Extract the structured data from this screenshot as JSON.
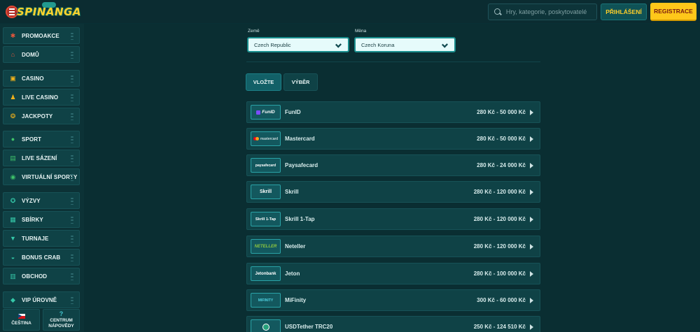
{
  "header": {
    "logo_text": "SPINANGA",
    "search_placeholder": "Hry, kategorie, poskytovatelé",
    "login_label": "PŘIHLÁŠENÍ",
    "register_label": "REGISTRACE"
  },
  "sidebar": {
    "items": [
      {
        "label": "PROMOAKCE",
        "icon": "gift-icon",
        "color": "#e0563c"
      },
      {
        "label": "DOMŮ",
        "icon": "home-icon",
        "color": "#e0563c"
      },
      {
        "label": "CASINO",
        "icon": "casino-icon",
        "color": "#f2b21b"
      },
      {
        "label": "LIVE CASINO",
        "icon": "live-casino-icon",
        "color": "#f2b21b"
      },
      {
        "label": "JACKPOTY",
        "icon": "jackpot-icon",
        "color": "#f2b21b"
      },
      {
        "label": "SPORT",
        "icon": "soccer-ball-icon",
        "color": "#3fc36a"
      },
      {
        "label": "LIVE SÁZENÍ",
        "icon": "live-bet-icon",
        "color": "#3fc36a"
      },
      {
        "label": "VIRTUÁLNÍ SPORTY",
        "icon": "virtual-sports-icon",
        "color": "#3fc36a"
      },
      {
        "label": "VÝZVY",
        "icon": "challenge-icon",
        "color": "#35c7a8"
      },
      {
        "label": "SBÍRKY",
        "icon": "collection-icon",
        "color": "#35c7a8"
      },
      {
        "label": "TURNAJE",
        "icon": "trophy-icon",
        "color": "#35c7a8"
      },
      {
        "label": "BONUS CRAB",
        "icon": "crab-icon",
        "color": "#35c7a8"
      },
      {
        "label": "OBCHOD",
        "icon": "shop-icon",
        "color": "#35c7a8"
      },
      {
        "label": "VIP ÚROVNĚ",
        "icon": "diamond-icon",
        "color": "#35c7a8"
      }
    ],
    "language_label": "ČEŠTINA",
    "help_label_1": "CENTRUM",
    "help_label_2": "NÁPOVĚDY",
    "help_icon": "?"
  },
  "form": {
    "country_label": "Země",
    "country_value": "Czech Republic",
    "currency_label": "Měna",
    "currency_value": "Czech Koruna"
  },
  "tabs": {
    "deposit_label": "VLOŽTE",
    "withdraw_label": "VÝBĚR"
  },
  "payments": [
    {
      "name": "FunID",
      "range": "280 Kč - 50 000 Kč",
      "logo_text": "FunID",
      "icon": "funid-logo"
    },
    {
      "name": "Mastercard",
      "range": "280 Kč - 50 000 Kč",
      "logo_text": "mastercard",
      "icon": "mastercard-logo"
    },
    {
      "name": "Paysafecard",
      "range": "280 Kč - 24 000 Kč",
      "logo_text": "paysafecard",
      "icon": "paysafecard-logo"
    },
    {
      "name": "Skrill",
      "range": "280 Kč - 120 000 Kč",
      "logo_text": "Skrill",
      "icon": "skrill-logo"
    },
    {
      "name": "Skrill 1-Tap",
      "range": "280 Kč - 120 000 Kč",
      "logo_text": "Skrill 1-Tap",
      "icon": "skrill-1tap-logo"
    },
    {
      "name": "Neteller",
      "range": "280 Kč - 120 000 Kč",
      "logo_text": "NETELLER",
      "icon": "neteller-logo"
    },
    {
      "name": "Jeton",
      "range": "280 Kč - 100 000 Kč",
      "logo_text": "Jetonbank",
      "icon": "jeton-logo"
    },
    {
      "name": "MiFinity",
      "range": "300 Kč - 60 000 Kč",
      "logo_text": "MIFINITY",
      "icon": "mifinity-logo"
    },
    {
      "name": "USDTether TRC20",
      "range": "250 Kč - 124 510 Kč",
      "logo_text": "",
      "icon": "usdt-logo"
    }
  ]
}
